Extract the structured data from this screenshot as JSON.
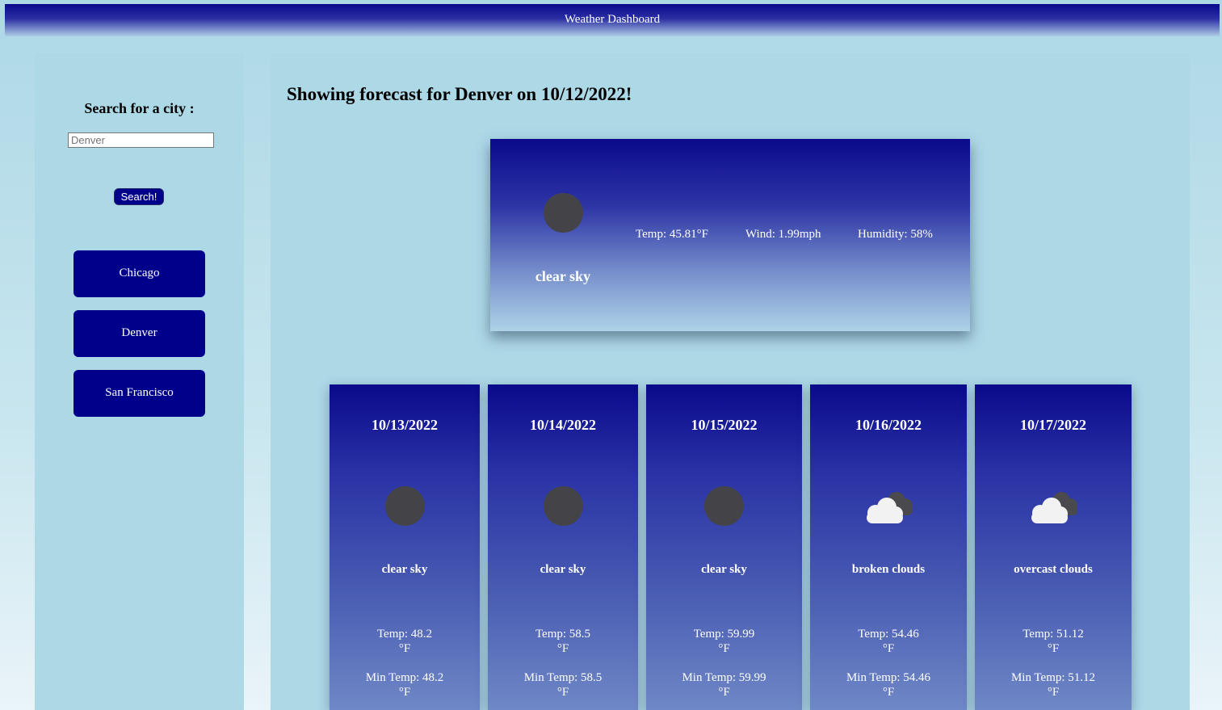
{
  "header": {
    "title": "Weather Dashboard"
  },
  "sidebar": {
    "search_label": "Search for a city :",
    "search_placeholder": "Denver",
    "search_button": "Search!",
    "cities": [
      "Chicago",
      "Denver",
      "San Francisco"
    ]
  },
  "main": {
    "title": "Showing forecast for Denver on 10/12/2022!",
    "today": {
      "icon": "moon-icon",
      "description": "clear sky",
      "temp": "Temp: 45.81°F",
      "wind": "Wind: 1.99mph",
      "humidity": "Humidity: 58%"
    },
    "forecast": [
      {
        "date": "10/13/2022",
        "icon": "moon-icon",
        "description": "clear sky",
        "temp": "Temp: 48.2",
        "min_temp": "Min Temp: 48.2",
        "unit": "°F"
      },
      {
        "date": "10/14/2022",
        "icon": "moon-icon",
        "description": "clear sky",
        "temp": "Temp: 58.5",
        "min_temp": "Min Temp: 58.5",
        "unit": "°F"
      },
      {
        "date": "10/15/2022",
        "icon": "moon-icon",
        "description": "clear sky",
        "temp": "Temp: 59.99",
        "min_temp": "Min Temp: 59.99",
        "unit": "°F"
      },
      {
        "date": "10/16/2022",
        "icon": "cloud-icon",
        "description": "broken clouds",
        "temp": "Temp: 54.46",
        "min_temp": "Min Temp: 54.46",
        "unit": "°F"
      },
      {
        "date": "10/17/2022",
        "icon": "cloud-icon",
        "description": "overcast clouds",
        "temp": "Temp: 51.12",
        "min_temp": "Min Temp: 51.12",
        "unit": "°F"
      }
    ]
  }
}
